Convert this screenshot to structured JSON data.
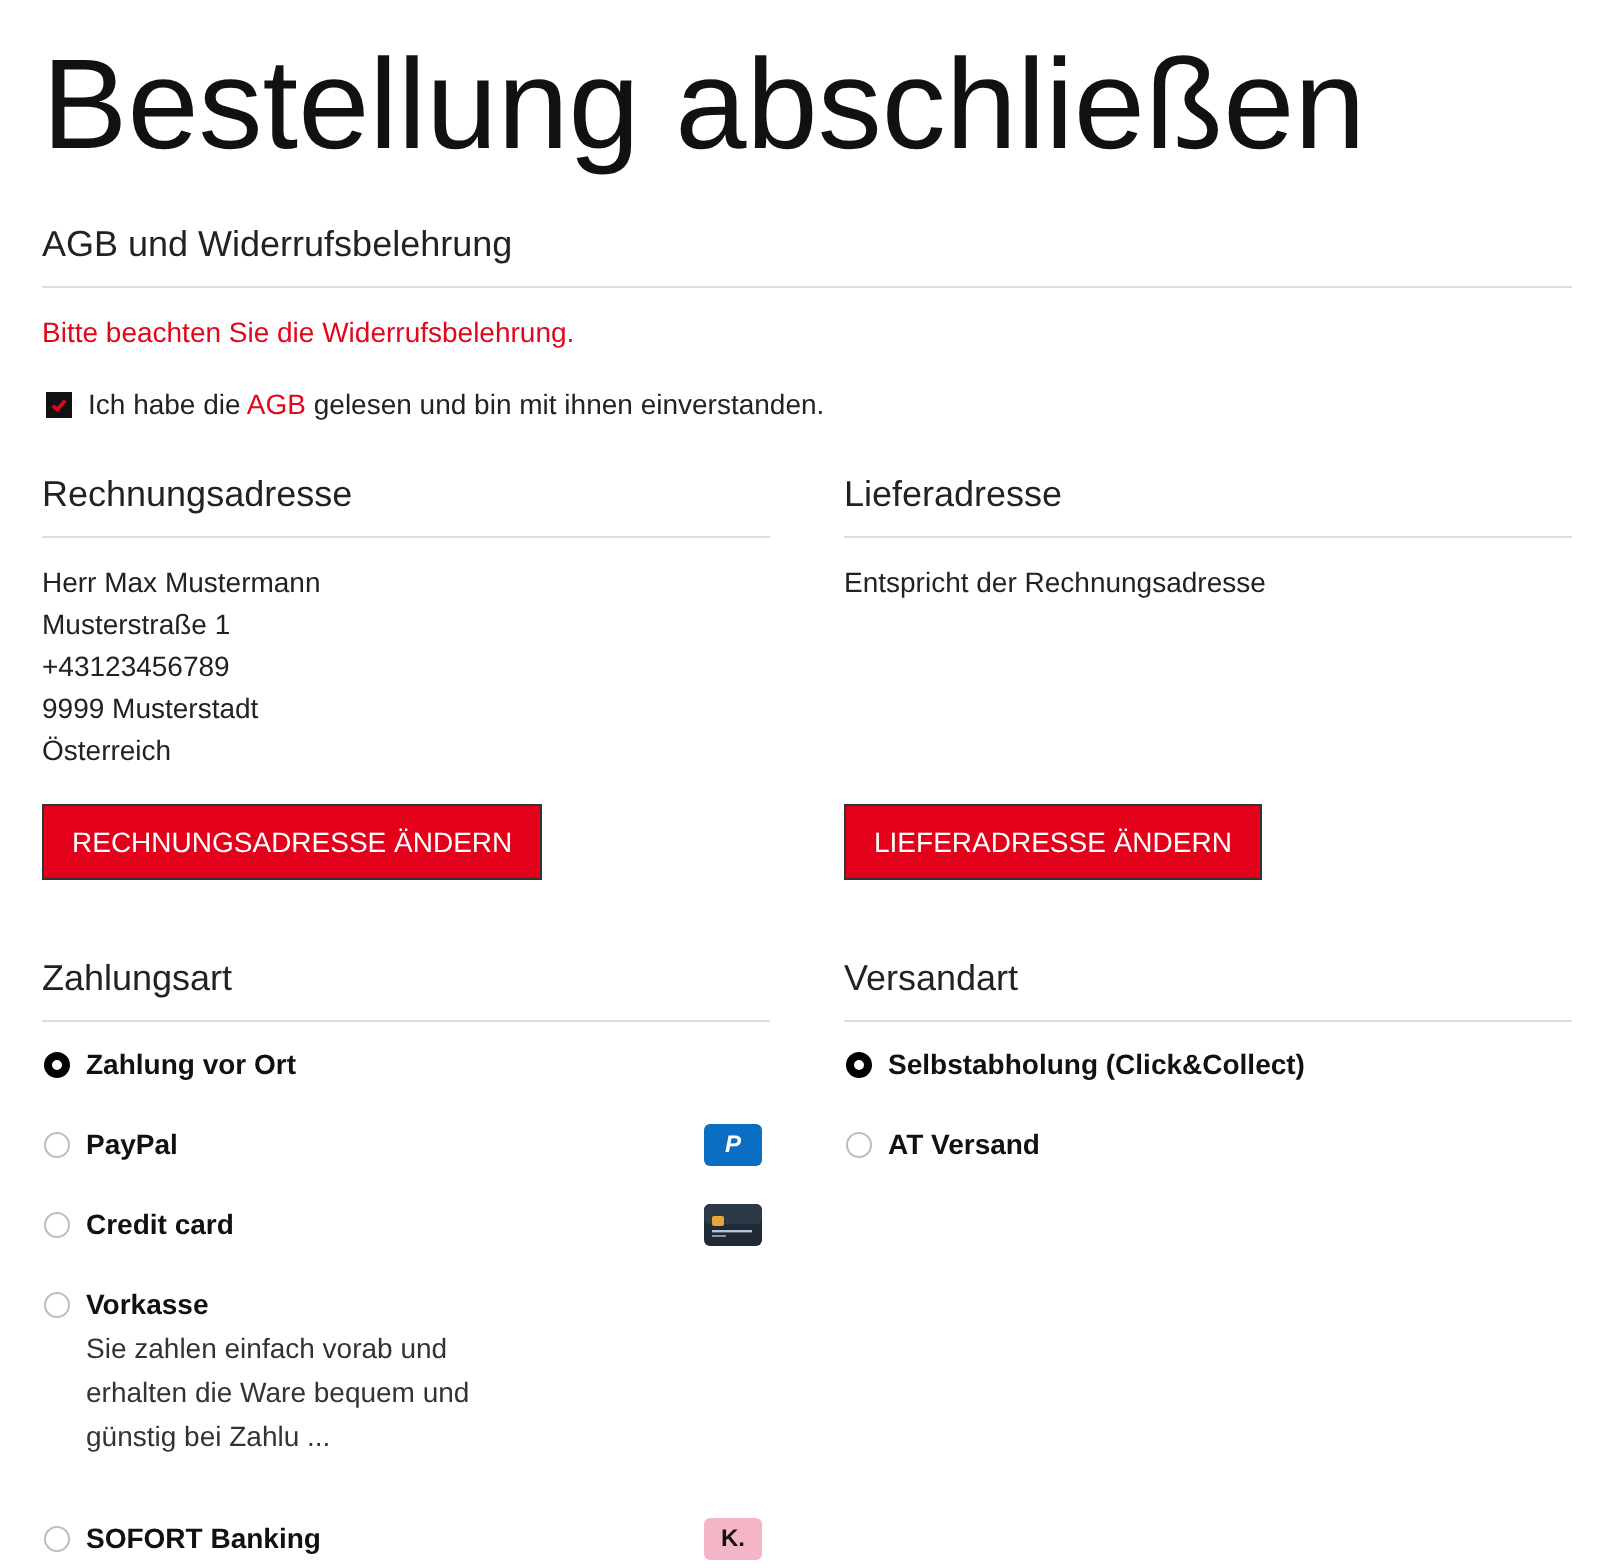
{
  "page": {
    "title": "Bestellung abschließen"
  },
  "terms": {
    "heading": "AGB und Widerrufsbelehrung",
    "notice": "Bitte beachten Sie die Widerrufsbelehrung.",
    "consent": {
      "checked": true,
      "text_before": "Ich habe die ",
      "link": "AGB",
      "text_after": " gelesen und bin mit ihnen einverstanden."
    }
  },
  "billing_address": {
    "heading": "Rechnungsadresse",
    "lines": [
      "Herr Max Mustermann",
      "Musterstraße 1",
      "+43123456789",
      "9999 Musterstadt",
      "Österreich"
    ],
    "button": "RECHNUNGSADRESSE ÄNDERN"
  },
  "shipping_address": {
    "heading": "Lieferadresse",
    "lines": [
      "Entspricht der Rechnungsadresse"
    ],
    "button": "LIEFERADRESSE ÄNDERN"
  },
  "payment": {
    "heading": "Zahlungsart",
    "methods": [
      {
        "label": "Zahlung vor Ort",
        "selected": true
      },
      {
        "label": "PayPal",
        "selected": false,
        "logo": {
          "kind": "paypal",
          "text": "P"
        }
      },
      {
        "label": "Credit card",
        "selected": false,
        "logo": {
          "kind": "card"
        }
      },
      {
        "label": "Vorkasse",
        "selected": false,
        "description": "Sie zahlen einfach vorab und erhalten die Ware bequem und günstig bei Zahlu ..."
      },
      {
        "label": "SOFORT Banking",
        "selected": false,
        "logo": {
          "kind": "klarna",
          "text": "K."
        }
      }
    ]
  },
  "shipping": {
    "heading": "Versandart",
    "methods": [
      {
        "label": "Selbstabholung (Click&Collect)",
        "selected": true
      },
      {
        "label": "AT Versand",
        "selected": false
      }
    ]
  }
}
